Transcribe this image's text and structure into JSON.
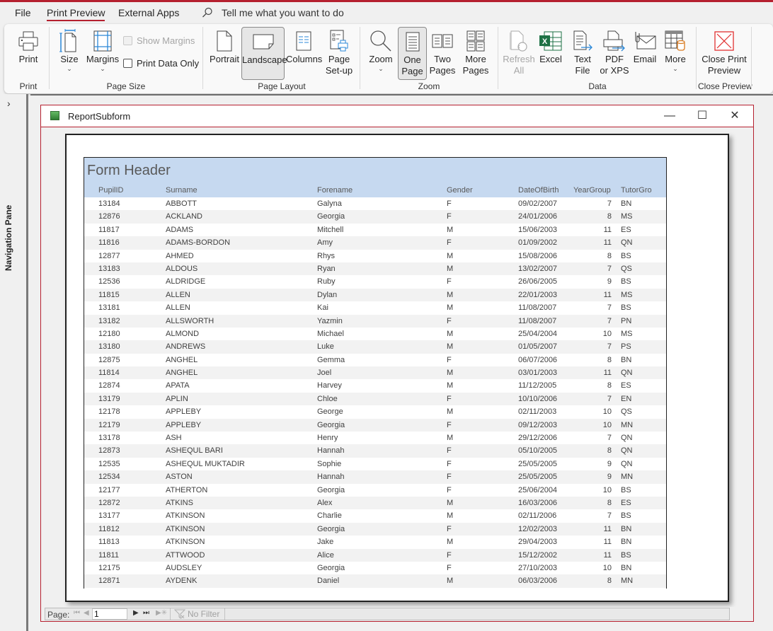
{
  "menubar": {
    "items": [
      "File",
      "Print Preview",
      "External Apps"
    ],
    "active": "Print Preview",
    "tell_me": "Tell me what you want to do"
  },
  "ribbon": {
    "groups": {
      "print": {
        "label": "Print",
        "print_button": "Print"
      },
      "page_size": {
        "label": "Page Size",
        "size_button": "Size",
        "margins_button": "Margins",
        "show_margins": {
          "label": "Show Margins",
          "checked": false,
          "enabled": false
        },
        "print_data_only": {
          "label": "Print Data Only",
          "checked": false,
          "enabled": true
        }
      },
      "page_layout": {
        "label": "Page Layout",
        "portrait_button": "Portrait",
        "landscape_button": "Landscape",
        "landscape_selected": true,
        "columns_button": "Columns",
        "page_setup_line1": "Page",
        "page_setup_line2": "Set-up"
      },
      "zoom": {
        "label": "Zoom",
        "zoom_button": "Zoom",
        "one_page_line1": "One",
        "one_page_line2": "Page",
        "one_page_selected": true,
        "two_pages_line1": "Two",
        "two_pages_line2": "Pages",
        "more_pages_line1": "More",
        "more_pages_line2": "Pages"
      },
      "data": {
        "label": "Data",
        "refresh_line1": "Refresh",
        "refresh_line2": "All",
        "excel_button": "Excel",
        "text_file_line1": "Text",
        "text_file_line2": "File",
        "pdf_line1": "PDF",
        "pdf_line2": "or XPS",
        "email_button": "Email",
        "more_button": "More"
      },
      "close_preview": {
        "label": "Close Preview",
        "close_line1": "Close Print",
        "close_line2": "Preview"
      }
    }
  },
  "nav_pane": {
    "label": "Navigation Pane",
    "toggle": "›"
  },
  "document": {
    "title": "ReportSubform",
    "controls": {
      "minimize": "—",
      "maximize": "☐",
      "close": "✕"
    },
    "form_header": "Form Header",
    "columns": [
      "PupilID",
      "Surname",
      "Forename",
      "Gender",
      "DateOfBirth",
      "YearGroup",
      "TutorGro"
    ],
    "rows": [
      [
        "13184",
        "ABBOTT",
        "Galyna",
        "F",
        "09/02/2007",
        "7",
        "BN"
      ],
      [
        "12876",
        "ACKLAND",
        "Georgia",
        "F",
        "24/01/2006",
        "8",
        "MS"
      ],
      [
        "11817",
        "ADAMS",
        "Mitchell",
        "M",
        "15/06/2003",
        "11",
        "ES"
      ],
      [
        "11816",
        "ADAMS-BORDON",
        "Amy",
        "F",
        "01/09/2002",
        "11",
        "QN"
      ],
      [
        "12877",
        "AHMED",
        "Rhys",
        "M",
        "15/08/2006",
        "8",
        "BS"
      ],
      [
        "13183",
        "ALDOUS",
        "Ryan",
        "M",
        "13/02/2007",
        "7",
        "QS"
      ],
      [
        "12536",
        "ALDRIDGE",
        "Ruby",
        "F",
        "26/06/2005",
        "9",
        "BS"
      ],
      [
        "11815",
        "ALLEN",
        "Dylan",
        "M",
        "22/01/2003",
        "11",
        "MS"
      ],
      [
        "13181",
        "ALLEN",
        "Kai",
        "M",
        "11/08/2007",
        "7",
        "BS"
      ],
      [
        "13182",
        "ALLSWORTH",
        "Yazmin",
        "F",
        "11/08/2007",
        "7",
        "PN"
      ],
      [
        "12180",
        "ALMOND",
        "Michael",
        "M",
        "25/04/2004",
        "10",
        "MS"
      ],
      [
        "13180",
        "ANDREWS",
        "Luke",
        "M",
        "01/05/2007",
        "7",
        "PS"
      ],
      [
        "12875",
        "ANGHEL",
        "Gemma",
        "F",
        "06/07/2006",
        "8",
        "BN"
      ],
      [
        "11814",
        "ANGHEL",
        "Joel",
        "M",
        "03/01/2003",
        "11",
        "QN"
      ],
      [
        "12874",
        "APATA",
        "Harvey",
        "M",
        "11/12/2005",
        "8",
        "ES"
      ],
      [
        "13179",
        "APLIN",
        "Chloe",
        "F",
        "10/10/2006",
        "7",
        "EN"
      ],
      [
        "12178",
        "APPLEBY",
        "George",
        "M",
        "02/11/2003",
        "10",
        "QS"
      ],
      [
        "12179",
        "APPLEBY",
        "Georgia",
        "F",
        "09/12/2003",
        "10",
        "MN"
      ],
      [
        "13178",
        "ASH",
        "Henry",
        "M",
        "29/12/2006",
        "7",
        "QN"
      ],
      [
        "12873",
        "ASHEQUL BARI",
        "Hannah",
        "F",
        "05/10/2005",
        "8",
        "QN"
      ],
      [
        "12535",
        "ASHEQUL MUKTADIR",
        "Sophie",
        "F",
        "25/05/2005",
        "9",
        "QN"
      ],
      [
        "12534",
        "ASTON",
        "Hannah",
        "F",
        "25/05/2005",
        "9",
        "MN"
      ],
      [
        "12177",
        "ATHERTON",
        "Georgia",
        "F",
        "25/06/2004",
        "10",
        "BS"
      ],
      [
        "12872",
        "ATKINS",
        "Alex",
        "M",
        "16/03/2006",
        "8",
        "ES"
      ],
      [
        "13177",
        "ATKINSON",
        "Charlie",
        "M",
        "02/11/2006",
        "7",
        "BS"
      ],
      [
        "11812",
        "ATKINSON",
        "Georgia",
        "F",
        "12/02/2003",
        "11",
        "BN"
      ],
      [
        "11813",
        "ATKINSON",
        "Jake",
        "M",
        "29/04/2003",
        "11",
        "BN"
      ],
      [
        "11811",
        "ATTWOOD",
        "Alice",
        "F",
        "15/12/2002",
        "11",
        "BS"
      ],
      [
        "12175",
        "AUDSLEY",
        "Georgia",
        "F",
        "27/10/2003",
        "10",
        "BN"
      ],
      [
        "12871",
        "AYDENK",
        "Daniel",
        "M",
        "06/03/2006",
        "8",
        "MN"
      ]
    ]
  },
  "statusbar": {
    "page_label": "Page:",
    "page_value": "1",
    "filter_label": "No Filter",
    "nav_first": "⏮",
    "nav_prev": "◀",
    "nav_next": "▶",
    "nav_last": "⏭",
    "nav_new": "▶✳"
  },
  "colors": {
    "accent": "#b5202f",
    "form_header_bg": "#c6d9f0",
    "alt_row_bg": "#f2f2f2"
  }
}
